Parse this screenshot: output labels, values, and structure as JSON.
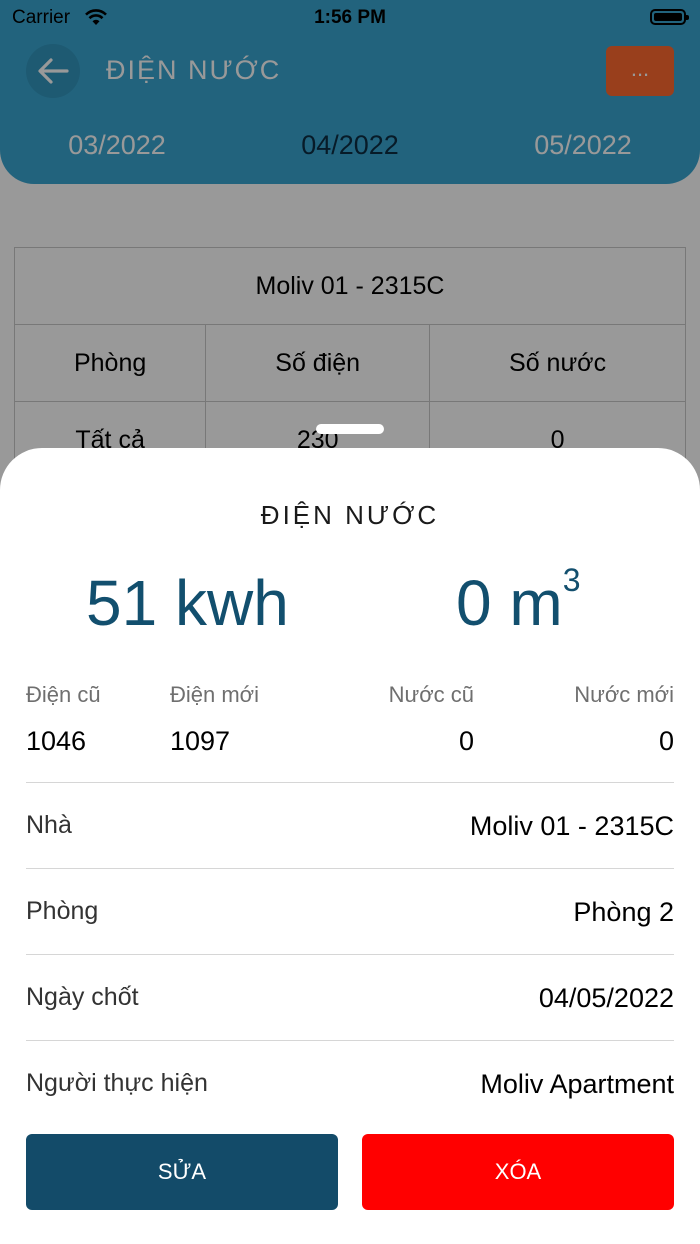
{
  "status_bar": {
    "carrier": "Carrier",
    "time": "1:56 PM"
  },
  "header": {
    "title": "ĐIỆN NƯỚC",
    "more_label": "...",
    "months": [
      "03/2022",
      "04/2022",
      "05/2022"
    ]
  },
  "background_table": {
    "house": "Moliv 01 - 2315C",
    "columns": [
      "Phòng",
      "Số điện",
      "Số nước"
    ],
    "rows": [
      {
        "room": "Tất cả",
        "electric": "230",
        "water": "0"
      }
    ]
  },
  "sheet": {
    "title": "ĐIỆN NƯỚC",
    "electric_usage": "51 kwh",
    "water_usage_value": "0 m",
    "water_usage_exponent": "3",
    "readings": {
      "old_electric_label": "Điện cũ",
      "old_electric": "1046",
      "new_electric_label": "Điện mới",
      "new_electric": "1097",
      "old_water_label": "Nước cũ",
      "old_water": "0",
      "new_water_label": "Nước mới",
      "new_water": "0"
    },
    "details": [
      {
        "label": "Nhà",
        "value": "Moliv 01 - 2315C"
      },
      {
        "label": "Phòng",
        "value": "Phòng 2"
      },
      {
        "label": "Ngày chốt",
        "value": "04/05/2022"
      },
      {
        "label": "Người thực hiện",
        "value": "Moliv Apartment"
      }
    ],
    "edit_label": "SỬA",
    "delete_label": "XÓA"
  },
  "colors": {
    "header": "#3aa6d1",
    "edit_button": "#134b69",
    "delete_button": "#ff0000",
    "more_button": "#ff6a2f",
    "usage_text": "#124f6e"
  }
}
